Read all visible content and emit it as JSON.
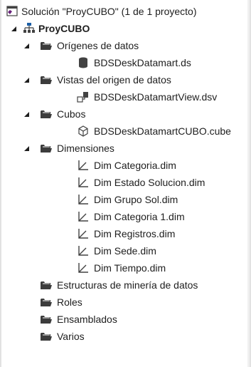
{
  "solution_explorer": {
    "solution": {
      "label": "Solución \"ProyCUBO\" (1 de 1 proyecto)",
      "icon": "solution-icon"
    },
    "project": {
      "label": "ProyCUBO",
      "icon": "project-icon"
    },
    "folders": [
      {
        "label": "Orígenes de datos",
        "items": [
          {
            "label": "BDSDeskDatamart.ds",
            "icon": "datasource-icon"
          }
        ]
      },
      {
        "label": "Vistas del origen de datos",
        "items": [
          {
            "label": "BDSDeskDatamartView.dsv",
            "icon": "dsv-icon"
          }
        ]
      },
      {
        "label": "Cubos",
        "items": [
          {
            "label": "BDSDeskDatamartCUBO.cube",
            "icon": "cube-icon"
          }
        ]
      },
      {
        "label": "Dimensiones",
        "items": [
          {
            "label": "Dim Categoria.dim",
            "icon": "dimension-icon"
          },
          {
            "label": "Dim Estado Solucion.dim",
            "icon": "dimension-icon"
          },
          {
            "label": "Dim Grupo Sol.dim",
            "icon": "dimension-icon"
          },
          {
            "label": "Dim Categoria 1.dim",
            "icon": "dimension-icon"
          },
          {
            "label": "Dim Registros.dim",
            "icon": "dimension-icon"
          },
          {
            "label": "Dim Sede.dim",
            "icon": "dimension-icon"
          },
          {
            "label": "Dim Tiempo.dim",
            "icon": "dimension-icon"
          }
        ]
      },
      {
        "label": "Estructuras de minería de datos",
        "items": []
      },
      {
        "label": "Roles",
        "items": []
      },
      {
        "label": "Ensamblados",
        "items": []
      },
      {
        "label": "Varios",
        "items": []
      }
    ],
    "colors": {
      "folder_fill": "#3c3c3c",
      "solution_purple": "#68217a",
      "project_blue": "#1c5fa6",
      "icon_gray": "#424242"
    }
  }
}
